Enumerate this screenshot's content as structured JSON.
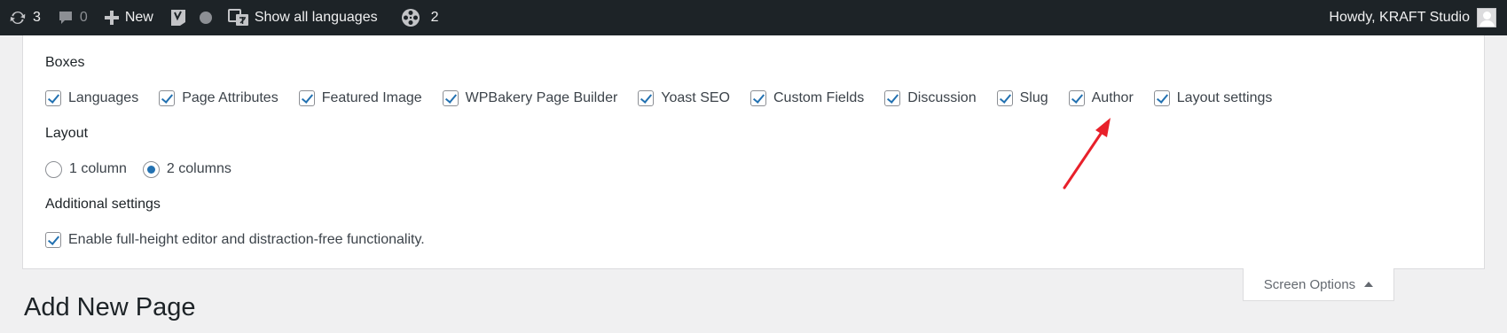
{
  "admin_bar": {
    "updates_count": "3",
    "comments_count": "0",
    "new_label": "New",
    "languages_label": "Show all languages",
    "plugin_count": "2",
    "greeting": "Howdy, KRAFT Studio"
  },
  "screen_options": {
    "boxes_heading": "Boxes",
    "boxes": [
      {
        "label": "Languages",
        "checked": true
      },
      {
        "label": "Page Attributes",
        "checked": true
      },
      {
        "label": "Featured Image",
        "checked": true
      },
      {
        "label": "WPBakery Page Builder",
        "checked": true
      },
      {
        "label": "Yoast SEO",
        "checked": true
      },
      {
        "label": "Custom Fields",
        "checked": true
      },
      {
        "label": "Discussion",
        "checked": true
      },
      {
        "label": "Slug",
        "checked": true
      },
      {
        "label": "Author",
        "checked": true
      },
      {
        "label": "Layout settings",
        "checked": true
      }
    ],
    "layout_heading": "Layout",
    "layout_options": [
      {
        "label": "1 column",
        "selected": false
      },
      {
        "label": "2 columns",
        "selected": true
      }
    ],
    "additional_heading": "Additional settings",
    "additional_option": {
      "label": "Enable full-height editor and distraction-free functionality.",
      "checked": true
    },
    "tab_label": "Screen Options"
  },
  "page": {
    "title": "Add New Page"
  },
  "colors": {
    "admin_bar_bg": "#1d2327",
    "accent": "#2271b1",
    "annotation": "#e8202a"
  }
}
